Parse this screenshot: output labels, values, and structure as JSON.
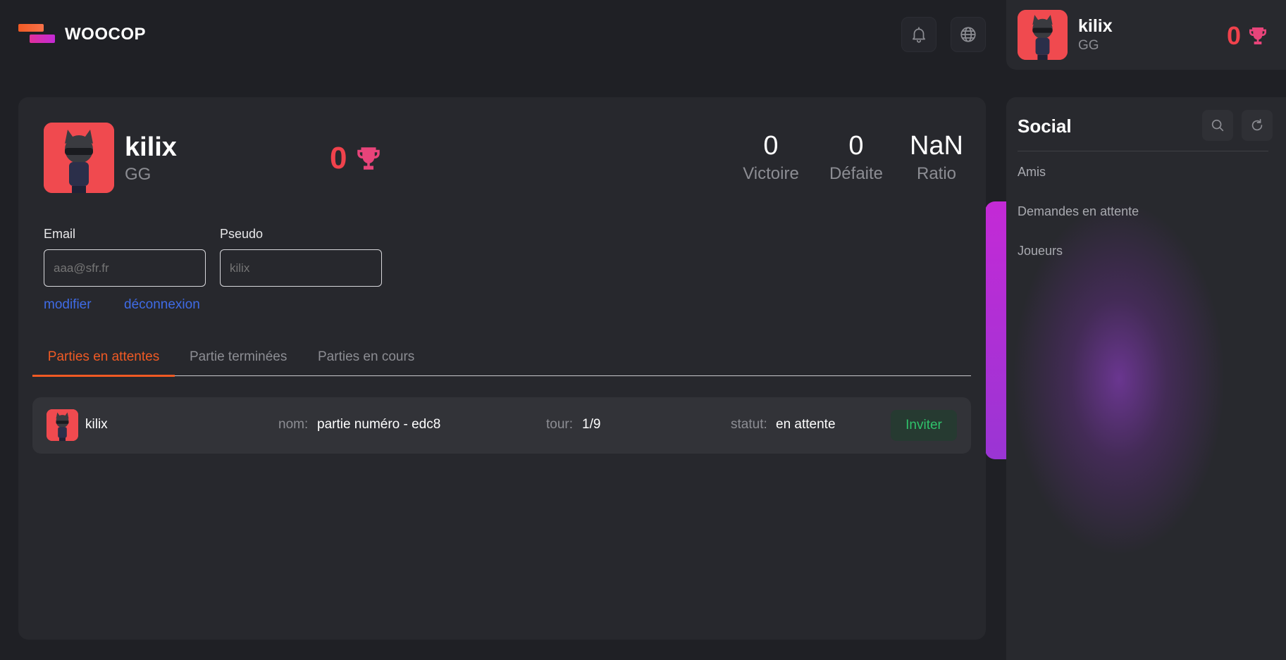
{
  "app": {
    "name": "WOOCOP"
  },
  "header": {
    "notifications_icon": "bell-icon",
    "language_icon": "globe-icon"
  },
  "user_card": {
    "name": "kilix",
    "subtitle": "GG",
    "trophies": "0"
  },
  "profile": {
    "name": "kilix",
    "subtitle": "GG",
    "trophies": "0",
    "stats": [
      {
        "value": "0",
        "label": "Victoire"
      },
      {
        "value": "0",
        "label": "Défaite"
      },
      {
        "value": "NaN",
        "label": "Ratio"
      }
    ],
    "email_label": "Email",
    "email_placeholder": "aaa@sfr.fr",
    "pseudo_label": "Pseudo",
    "pseudo_placeholder": "kilix",
    "edit_link": "modifier",
    "logout_link": "déconnexion"
  },
  "tabs": [
    {
      "label": "Parties en attentes",
      "active": true
    },
    {
      "label": "Partie terminées",
      "active": false
    },
    {
      "label": "Parties en cours",
      "active": false
    }
  ],
  "games": [
    {
      "player": "kilix",
      "name_key": "nom:",
      "name_value": "partie numéro - edc8",
      "turn_key": "tour:",
      "turn_value": "1/9",
      "status_key": "statut:",
      "status_value": "en attente",
      "action": "Inviter"
    }
  ],
  "social": {
    "title": "Social",
    "items": [
      "Amis",
      "Demandes en attente",
      "Joueurs"
    ]
  },
  "colors": {
    "accent": "#f05a24",
    "trophy": "#f0424c",
    "link": "#3f6be6",
    "success": "#2fc26b",
    "avatar_bg": "#f04a4f"
  }
}
